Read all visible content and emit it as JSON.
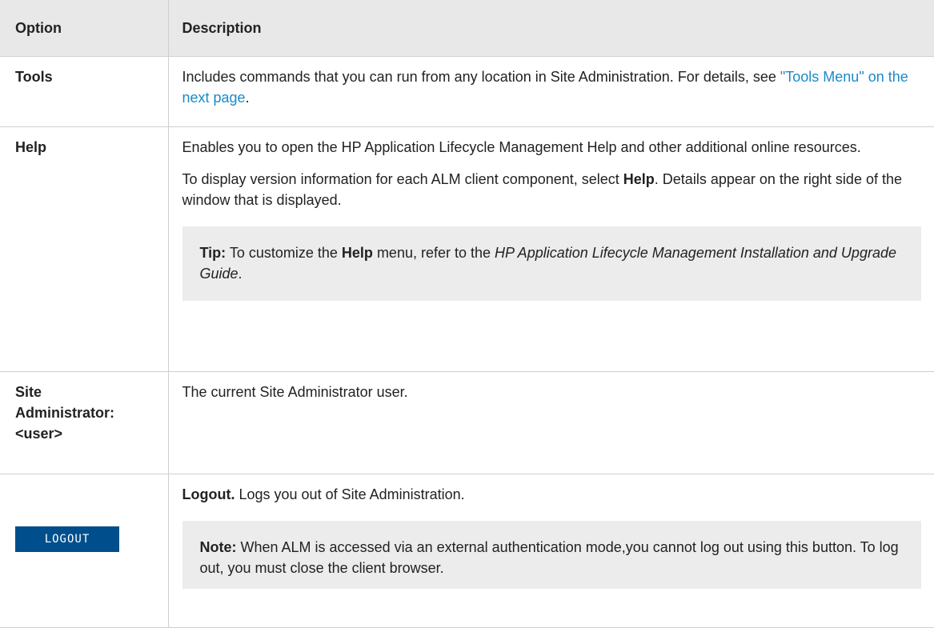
{
  "headers": {
    "option": "Option",
    "description": "Description"
  },
  "rows": {
    "tools": {
      "option": "Tools",
      "desc_text": "Includes commands that you can run from any location in Site Administration. For details, see ",
      "desc_link": "\"Tools Menu\" on the next page",
      "desc_end": "."
    },
    "help": {
      "option": "Help",
      "p1": "Enables you to open the HP Application Lifecycle Management Help and other additional online resources.",
      "p2_start": "To display version information for each ALM client component, select ",
      "p2_bold": "Help",
      "p2_end": ". Details appear on the right side of the window that is displayed.",
      "tip_label": "Tip:",
      "tip_text1": " To customize the ",
      "tip_bold": "Help",
      "tip_text2": " menu, refer to the ",
      "tip_italic": "HP Application Lifecycle Management Installation and Upgrade Guide",
      "tip_end": "."
    },
    "site_admin": {
      "option_line1": "Site",
      "option_line2": "Administrator:",
      "option_line3": "<user>",
      "desc": "The current Site Administrator user."
    },
    "logout": {
      "button_label": "LOGOUT",
      "desc_bold": "Logout.",
      "desc_text": " Logs you out of Site Administration.",
      "note_label": "Note:",
      "note_text": " When ALM is accessed via an external authentication mode,you cannot log out using this button. To log out, you must close the client browser."
    }
  },
  "colors": {
    "header_bg": "#e8e8e8",
    "note_bg": "#ececec",
    "link": "#1a8ac6",
    "logout_bg": "#004f8c"
  }
}
